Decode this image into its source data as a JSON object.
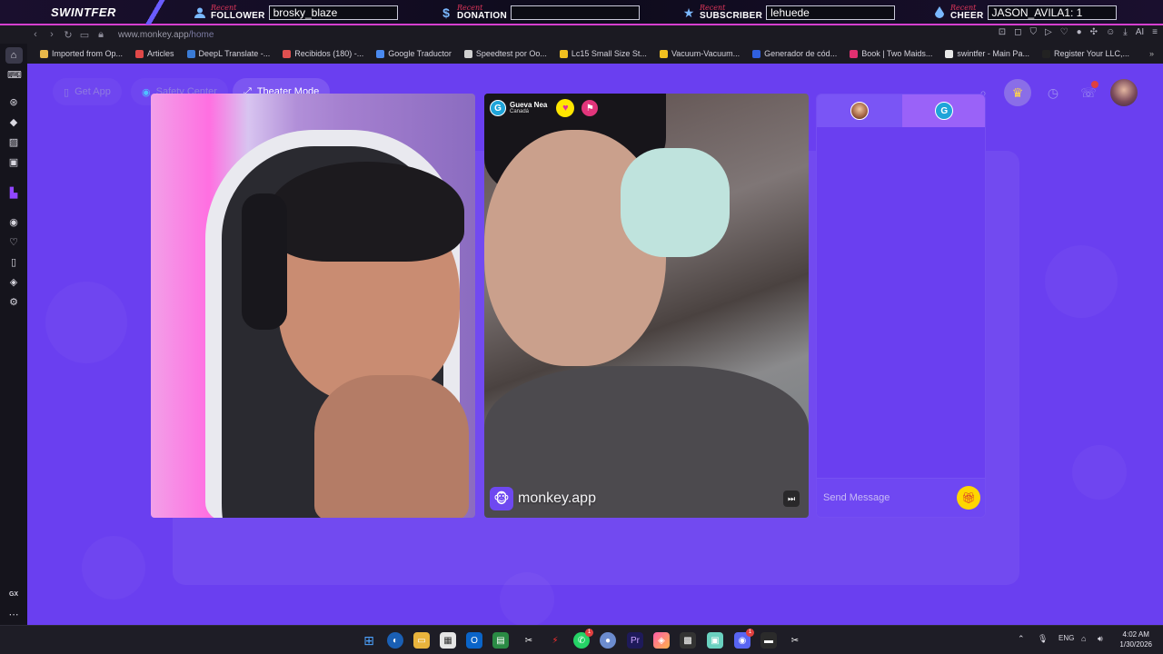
{
  "overlay": {
    "brand": "SWINTFER",
    "items": [
      {
        "icon": "person-icon",
        "recent": "Recent",
        "type": "FOLLOWER",
        "value": "brosky_blaze"
      },
      {
        "icon": "dollar-icon",
        "recent": "Recent",
        "type": "DONATION",
        "value": ""
      },
      {
        "icon": "star-icon",
        "recent": "Recent",
        "type": "SUBSCRIBER",
        "value": "lehuede"
      },
      {
        "icon": "drop-icon",
        "recent": "Recent",
        "type": "CHEER",
        "value": "JASON_AVILA1: 1"
      }
    ]
  },
  "browser": {
    "url_host": "www.monkey.app",
    "url_path": "/home",
    "ai_label": "AI",
    "bookmarks": [
      {
        "label": "Imported from Op...",
        "color": "#e8b84a"
      },
      {
        "label": "Articles",
        "color": "#e04848"
      },
      {
        "label": "DeepL Translate -...",
        "color": "#3a7bd5"
      },
      {
        "label": "Recibidos (180) -...",
        "color": "#e05050"
      },
      {
        "label": "Google Traductor",
        "color": "#4a8af0"
      },
      {
        "label": "Speedtest por Oo...",
        "color": "#d0d0d0"
      },
      {
        "label": "Lc15 Small Size St...",
        "color": "#f0c020"
      },
      {
        "label": "Vacuum-Vacuum...",
        "color": "#f0c020"
      },
      {
        "label": "Generador de cód...",
        "color": "#3060e0"
      },
      {
        "label": "Book | Two Maids...",
        "color": "#e03070"
      },
      {
        "label": "swintfer - Main Pa...",
        "color": "#e8e8e8"
      },
      {
        "label": "Register Your LLC,...",
        "color": "#222222"
      }
    ],
    "sidebar_bottom_label": "GX"
  },
  "app": {
    "nav": {
      "get_app": "Get App",
      "safety_center": "Safety Center",
      "theater_mode": "Theater Mode"
    },
    "notification_count": "1",
    "remote_user": {
      "name": "Gueva Nea",
      "country": "Canadá",
      "avatar_letter": "G"
    },
    "watermark": "monkey.app",
    "chat": {
      "tab2_letter": "G",
      "placeholder": "Send Message"
    }
  },
  "taskbar": {
    "badges": {
      "whatsapp": "1",
      "discord": "1"
    },
    "lang": "ENG",
    "time": "4:02 AM",
    "date": "1/30/2026"
  }
}
